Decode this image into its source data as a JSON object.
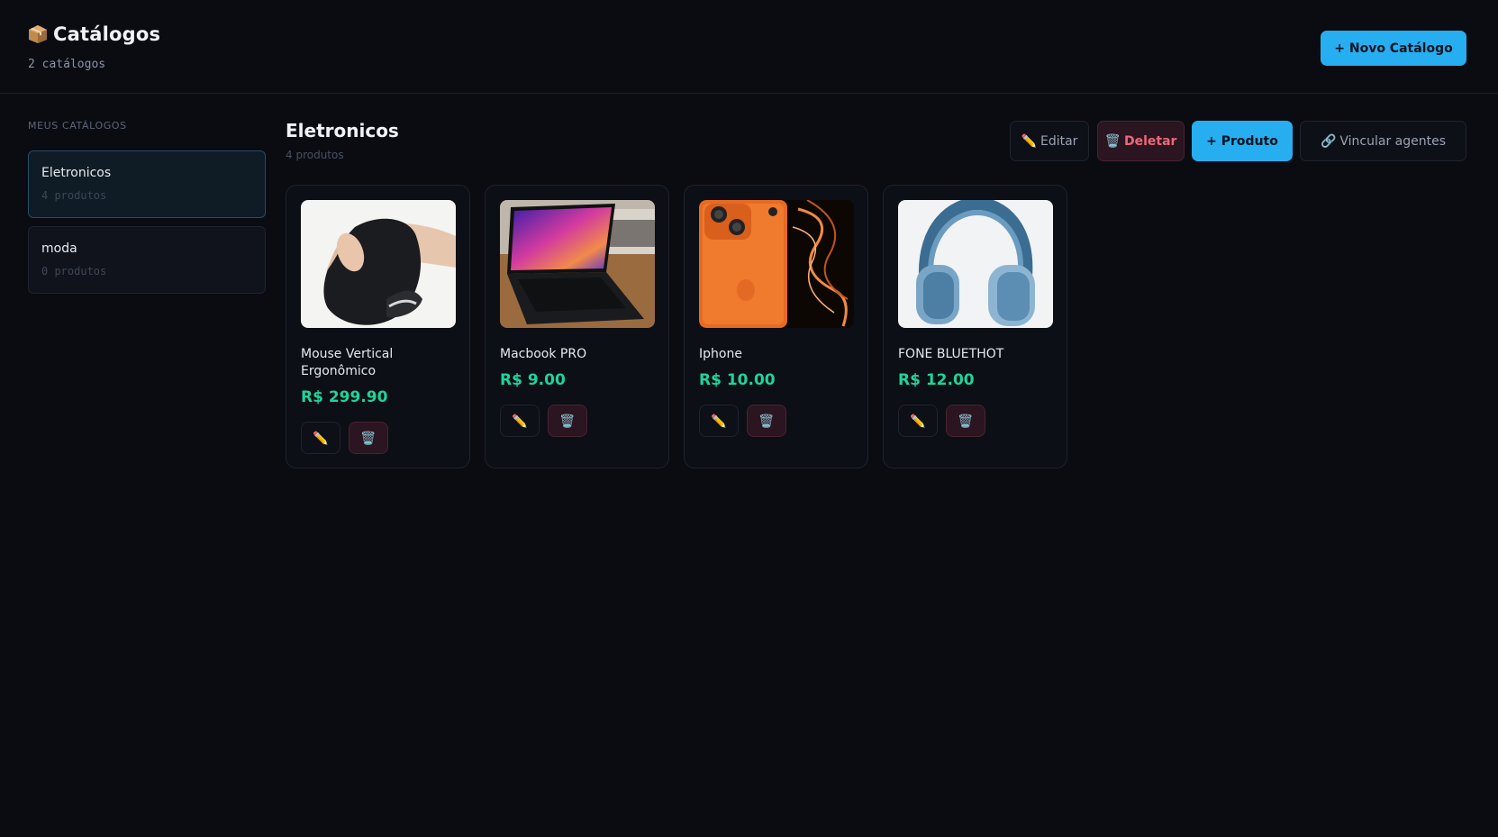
{
  "header": {
    "title": "Catálogos",
    "subtitle": "2 catálogos",
    "new_catalog_label": "+ Novo Catálogo"
  },
  "sidebar": {
    "label": "MEUS CATÁLOGOS",
    "items": [
      {
        "name": "Eletronicos",
        "count": "4 produtos",
        "active": true
      },
      {
        "name": "moda",
        "count": "0 produtos",
        "active": false
      }
    ]
  },
  "main": {
    "title": "Eletronicos",
    "subtitle": "4 produtos",
    "toolbar": {
      "edit_label": "Editar",
      "delete_label": "Deletar",
      "add_product_label": "+ Produto",
      "link_agents_label": "Vincular agentes"
    },
    "products": [
      {
        "name": "Mouse Vertical Ergonômico",
        "price": "R$ 299.90",
        "image_icon": "vertical-mouse-photo"
      },
      {
        "name": "Macbook PRO",
        "price": "R$ 9.00",
        "image_icon": "laptop-photo"
      },
      {
        "name": "Iphone",
        "price": "R$ 10.00",
        "image_icon": "phone-photo"
      },
      {
        "name": "FONE BLUETHOT",
        "price": "R$ 12.00",
        "image_icon": "headphones-photo"
      }
    ]
  },
  "icons": {
    "edit": "✏️",
    "delete": "🗑️",
    "link": "🔗"
  },
  "colors": {
    "accent": "#27aef0",
    "price": "#1ed49a",
    "danger": "#f0667a",
    "background": "#0a0c12"
  }
}
